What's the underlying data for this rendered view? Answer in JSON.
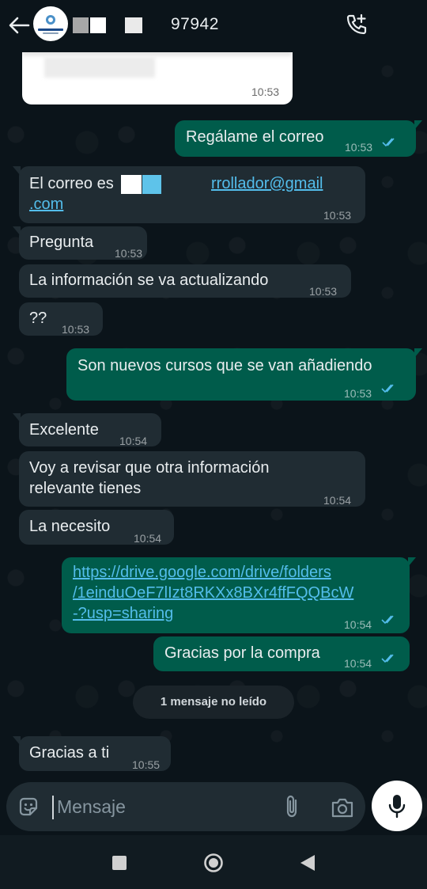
{
  "header": {
    "contact_name": "97942"
  },
  "messages": [
    {
      "id": "m0",
      "direction": "in",
      "kind": "image",
      "time": "10:53"
    },
    {
      "id": "m1",
      "direction": "out",
      "text": "Regálame el correo",
      "time": "10:53",
      "status": "read"
    },
    {
      "id": "m2",
      "direction": "in",
      "text_prefix": "El correo es",
      "text_link_1": "rrollador@gmail",
      "text_link_2": ".com",
      "time": "10:53"
    },
    {
      "id": "m3",
      "direction": "in",
      "text": "Pregunta",
      "time": "10:53"
    },
    {
      "id": "m4",
      "direction": "in",
      "text": "La información se va actualizando",
      "time": "10:53"
    },
    {
      "id": "m5",
      "direction": "in",
      "text": "??",
      "time": "10:53"
    },
    {
      "id": "m6",
      "direction": "out",
      "text": "Son nuevos cursos que se van añadiendo",
      "time": "10:53",
      "status": "read"
    },
    {
      "id": "m7",
      "direction": "in",
      "text": "Excelente",
      "time": "10:54"
    },
    {
      "id": "m8",
      "direction": "in",
      "text_line1": "Voy a revisar que otra información",
      "text_line2": "relevante tienes",
      "time": "10:54"
    },
    {
      "id": "m9",
      "direction": "in",
      "text": "La necesito",
      "time": "10:54"
    },
    {
      "id": "m10",
      "direction": "out",
      "link_line1": "https://drive.google.com/drive/folders",
      "link_line2": "/1einduOeF7lIzt8RKXx8BXr4ffFQQBcW",
      "link_line3": "-?usp=sharing",
      "time": "10:54",
      "status": "read"
    },
    {
      "id": "m11",
      "direction": "out",
      "text": "Gracias por la compra",
      "time": "10:54",
      "status": "read"
    },
    {
      "id": "m12",
      "direction": "in",
      "text": "Gracias a ti",
      "time": "10:55"
    }
  ],
  "unread_banner": "1 mensaje no leído",
  "composer": {
    "placeholder": "Mensaje"
  },
  "icons": {
    "back": "arrow-left-icon",
    "call": "add-call-icon",
    "emoji": "sticker-icon",
    "attach": "paperclip-icon",
    "camera": "camera-icon",
    "mic": "microphone-icon"
  },
  "colors": {
    "background": "#0b141a",
    "incoming_bubble": "#202c33",
    "outgoing_bubble": "#005c4b",
    "link": "#53bdeb",
    "read_ticks": "#53bdeb"
  }
}
